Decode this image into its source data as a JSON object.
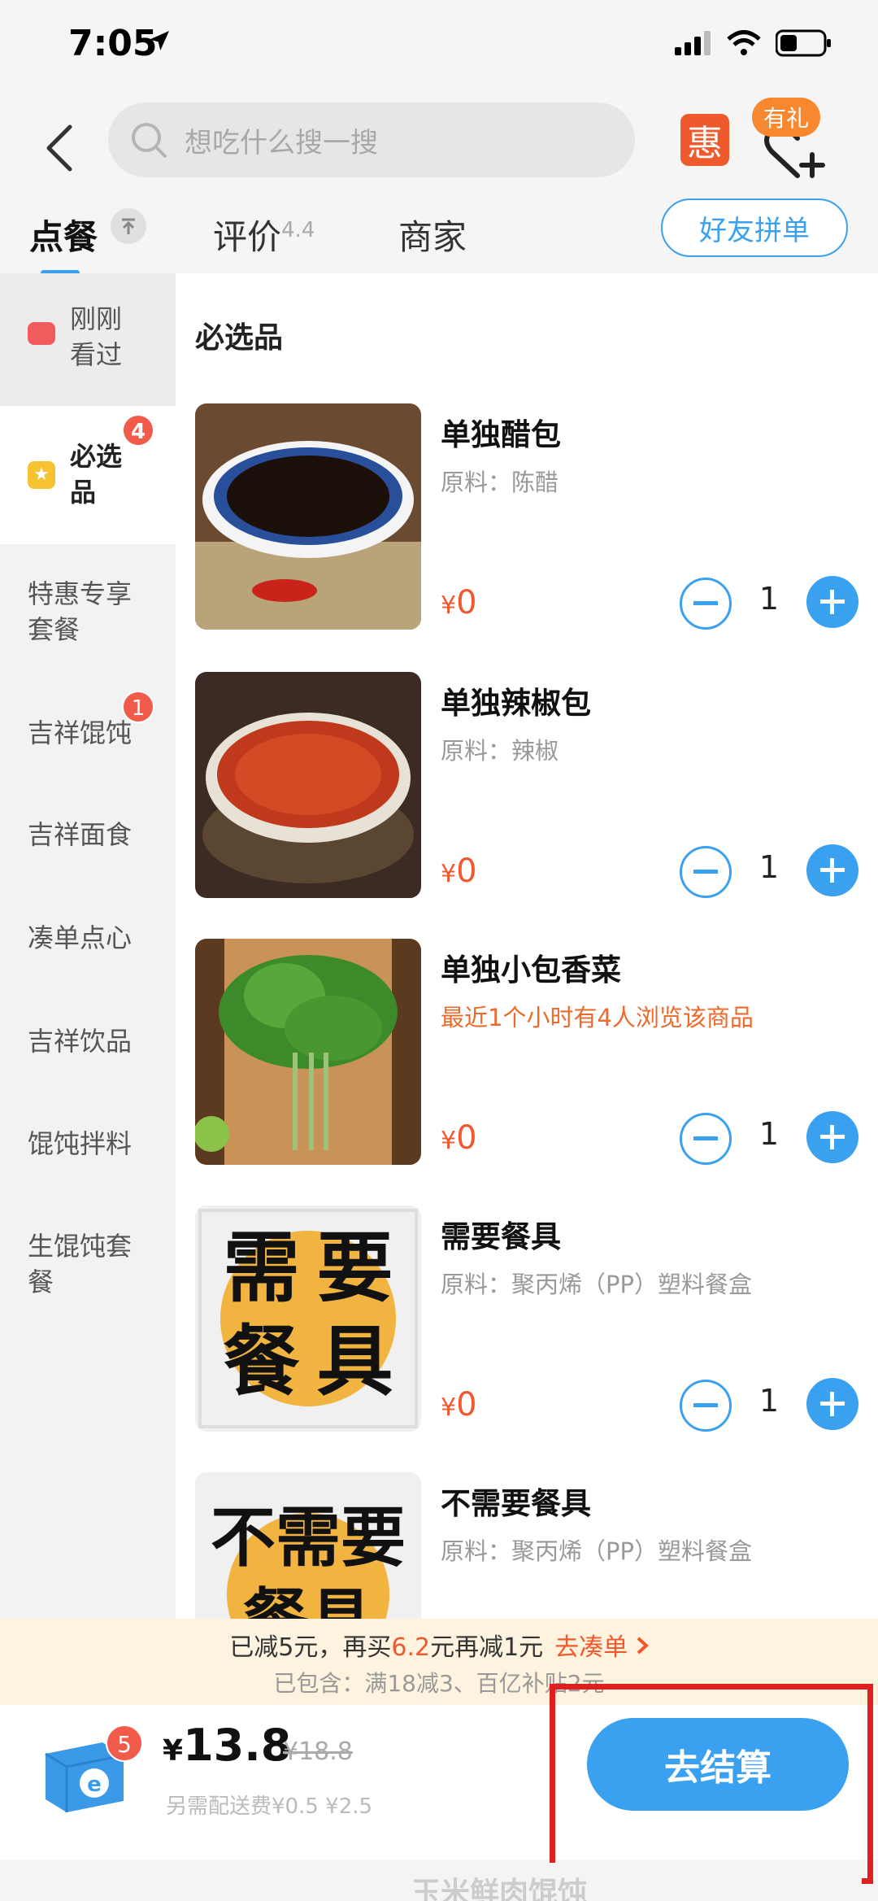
{
  "status_bar": {
    "time": "7:05"
  },
  "header": {
    "search_placeholder": "想吃什么搜一搜",
    "hui_label": "惠",
    "gift_badge": "有礼"
  },
  "tabs": [
    {
      "label": "点餐"
    },
    {
      "label": "评价",
      "rating": "4.4"
    },
    {
      "label": "商家"
    }
  ],
  "friend_order_label": "好友拼单",
  "sidebar": {
    "recent": "刚刚看过",
    "selected": {
      "label": "必选品",
      "badge": "4"
    },
    "items": [
      {
        "label": "特惠专享套餐"
      },
      {
        "label": "吉祥馄饨",
        "badge": "1"
      },
      {
        "label": "吉祥面食"
      },
      {
        "label": "凑单点心"
      },
      {
        "label": "吉祥饮品"
      },
      {
        "label": "馄饨拌料"
      },
      {
        "label": "生馄饨套餐"
      }
    ]
  },
  "section_title": "必选品",
  "products": [
    {
      "name": "单独醋包",
      "desc": "原料：陈醋",
      "price": "0",
      "qty": "1"
    },
    {
      "name": "单独辣椒包",
      "desc": "原料：辣椒",
      "price": "0",
      "qty": "1"
    },
    {
      "name": "单独小包香菜",
      "desc": "最近1个小时有4人浏览该商品",
      "price": "0",
      "qty": "1"
    },
    {
      "name": "需要餐具",
      "desc": "原料：聚丙烯（PP）塑料餐盒",
      "price": "0",
      "qty": "1",
      "img_text": [
        "需",
        "要",
        "餐",
        "具"
      ]
    },
    {
      "name": "不需要餐具",
      "desc": "原料：聚丙烯（PP）塑料餐盒",
      "img_text": "不需要餐具"
    }
  ],
  "promo": {
    "line1_a": "已减5元，再买",
    "line1_hl": "6.2",
    "line1_b": "元再减1元",
    "line1_link": "去凑单",
    "line2": "已包含：满18减3、百亿补贴2元"
  },
  "cart": {
    "badge": "5",
    "price": "13.8",
    "original_price": "¥18.8",
    "fee": "另需配送费¥0.5 ¥2.5",
    "checkout_label": "去结算"
  },
  "bottom_peek": "玉米鲜肉馄饨",
  "colors": {
    "accent": "#3aa0f0",
    "price": "#f0582d",
    "badge": "#f15b4a",
    "highlight": "#e02020"
  }
}
